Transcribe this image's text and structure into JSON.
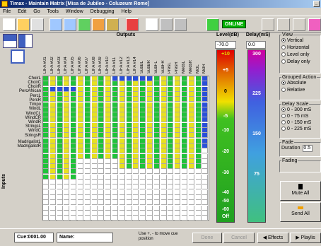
{
  "window": {
    "title": "Timax - Maintain Matrix  [Misa de Jubileo - Coluzeum Rome]"
  },
  "menu": [
    "File",
    "Edit",
    "Go",
    "Tools",
    "Window",
    "Debugging",
    "Help"
  ],
  "status": {
    "online": "ONLINE"
  },
  "matrix": {
    "outputs_title": "Outputs",
    "inputs_title": "Inputs",
    "columns": [
      "LIFA #01",
      "LIFA #02",
      "LIFA #03",
      "LIFA #04",
      "LIFA #05",
      "LIFA #06",
      "LIFA #07",
      "LIFA #08",
      "LIFA #09",
      "LIFA #10",
      "LIFA #11",
      "LIFA #12",
      "LIFA #13",
      "LIFA #14",
      "SubBL",
      "SubBR",
      "SubFL",
      "SubFR",
      "PresL",
      "PresR",
      "MedsL",
      "MedsR",
      "MclL",
      "MclR"
    ],
    "rows": [
      "ChoirL",
      "ChoirC",
      "ChoirR",
      "PercAfrican",
      "PercL",
      "PercR",
      "Timpo",
      "WindL",
      "WindCL",
      "WindCR",
      "WindR",
      "StringsL",
      "WindC",
      "StringsR",
      "MadrigalistL",
      "MadrigalistR"
    ]
  },
  "level": {
    "title": "Level(dB)",
    "value": "-70.0",
    "scale": [
      "+10",
      "+5",
      "0",
      "-5",
      "-10",
      "-20",
      "-30",
      "-40",
      "-50",
      "-60",
      "Off"
    ]
  },
  "delay": {
    "title": "Delay(mS)",
    "value": "0.0",
    "scale": [
      "300",
      "225",
      "150",
      "75"
    ]
  },
  "view": {
    "title": "View",
    "options": [
      "Vertical",
      "Horizontal",
      "Level only",
      "Delay only"
    ],
    "selected": "Vertical"
  },
  "grouped": {
    "title": "Grouped Action",
    "options": [
      "Absolute",
      "Relative"
    ],
    "selected": "Absolute"
  },
  "delay_scale": {
    "title": "Delay Scale",
    "options": [
      "0 - 300 mS",
      "0 -  75 mS",
      "0 - 150 mS",
      "0 - 225 mS"
    ],
    "selected": "0 - 300 mS"
  },
  "fade": {
    "title": "Fade",
    "duration_label": "Duration",
    "duration_value": "0.5"
  },
  "fading": {
    "title": "Fading"
  },
  "buttons": {
    "mute_all": "Mute All",
    "send_all": "Send All"
  },
  "statusbar": {
    "cue": "Cue:0001.00",
    "name_label": "Name:",
    "hint": "Use +, - to move cue position",
    "done": "Done",
    "cancel": "Cancel",
    "effects": "Effects",
    "playlist": "Playlis"
  },
  "colors": {
    "green": "#1fc23a",
    "yellow": "#e8e020",
    "blue": "#2a4fd8",
    "white": "#ffffff",
    "grey": "#d4d0c8"
  }
}
